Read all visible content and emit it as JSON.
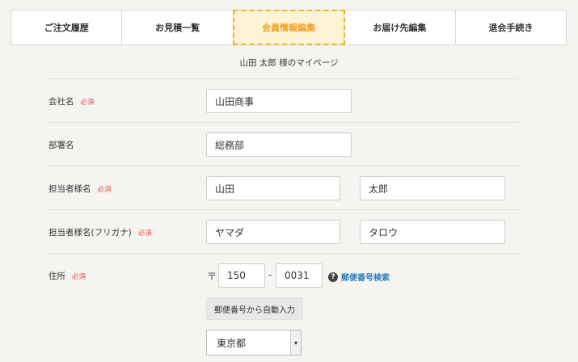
{
  "tabs": [
    {
      "label": "ご注文履歴",
      "active": false
    },
    {
      "label": "お見積一覧",
      "active": false
    },
    {
      "label": "会員情報編集",
      "active": true
    },
    {
      "label": "お届け先編集",
      "active": false
    },
    {
      "label": "退会手続き",
      "active": false
    }
  ],
  "greeting": "山田 太郎 様のマイページ",
  "required_label": "必須",
  "form": {
    "company": {
      "label": "会社名",
      "value": "山田商事"
    },
    "department": {
      "label": "部署名",
      "value": "総務部"
    },
    "contact_name": {
      "label": "担当者様名",
      "last": "山田",
      "first": "太郎"
    },
    "contact_kana": {
      "label": "担当者様名(フリガナ)",
      "last": "ヤマダ",
      "first": "タロウ"
    },
    "address": {
      "label": "住所",
      "postal_mark": "〒",
      "zip1": "150",
      "zip2": "0031",
      "zip_search_label": "郵便番号検索",
      "autofill_button": "郵便番号から自動入力",
      "prefecture": "東京都"
    }
  },
  "colors": {
    "accent": "#f0a020",
    "required": "#e0504a",
    "link": "#2a7fbf"
  }
}
